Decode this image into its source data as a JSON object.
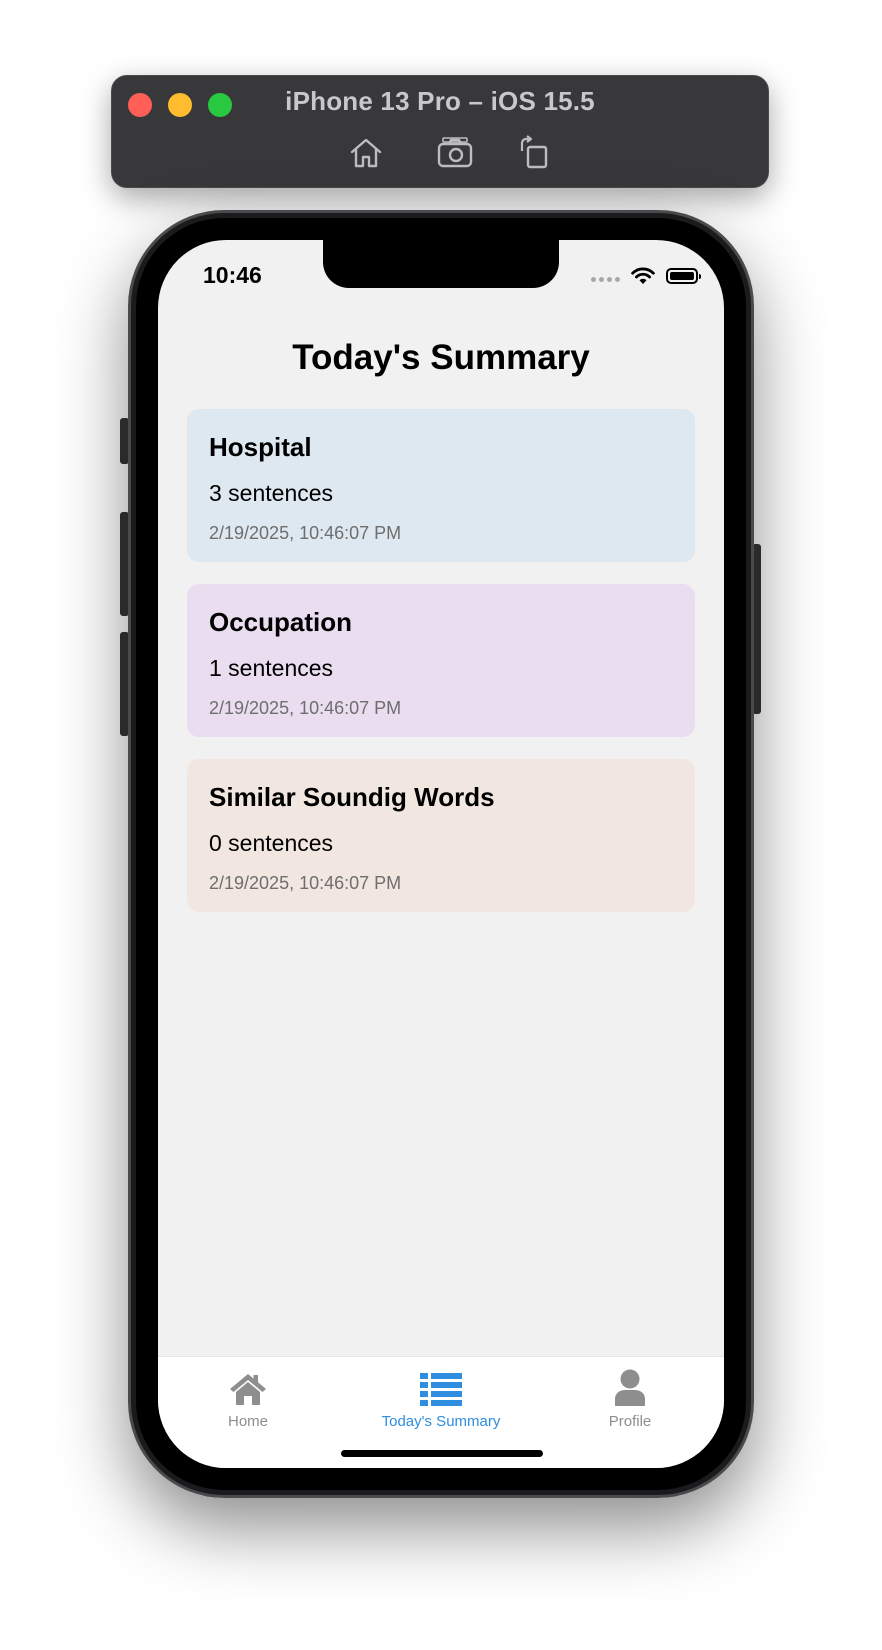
{
  "simulator": {
    "title": "iPhone 13 Pro – iOS 15.5",
    "toolbar": [
      "home-icon",
      "screenshot-icon",
      "rotate-icon"
    ]
  },
  "status_bar": {
    "time": "10:46"
  },
  "screen": {
    "title": "Today's Summary",
    "cards": [
      {
        "title": "Hospital",
        "count": "3 sentences",
        "date": "2/19/2025, 10:46:07 PM",
        "color": "#dde8f0"
      },
      {
        "title": "Occupation",
        "count": "1 sentences",
        "date": "2/19/2025, 10:46:07 PM",
        "color": "#e9ddef"
      },
      {
        "title": "Similar Soundig Words",
        "count": "0 sentences",
        "date": "2/19/2025, 10:46:07 PM",
        "color": "#f2e6e0"
      }
    ]
  },
  "tab_bar": {
    "tabs": [
      {
        "label": "Home",
        "icon": "home-icon",
        "active": false
      },
      {
        "label": "Today's Summary",
        "icon": "list-icon",
        "active": true
      },
      {
        "label": "Profile",
        "icon": "user-icon",
        "active": false
      }
    ],
    "active_color": "#2f8ee0",
    "inactive_color": "#8e8e8e"
  }
}
